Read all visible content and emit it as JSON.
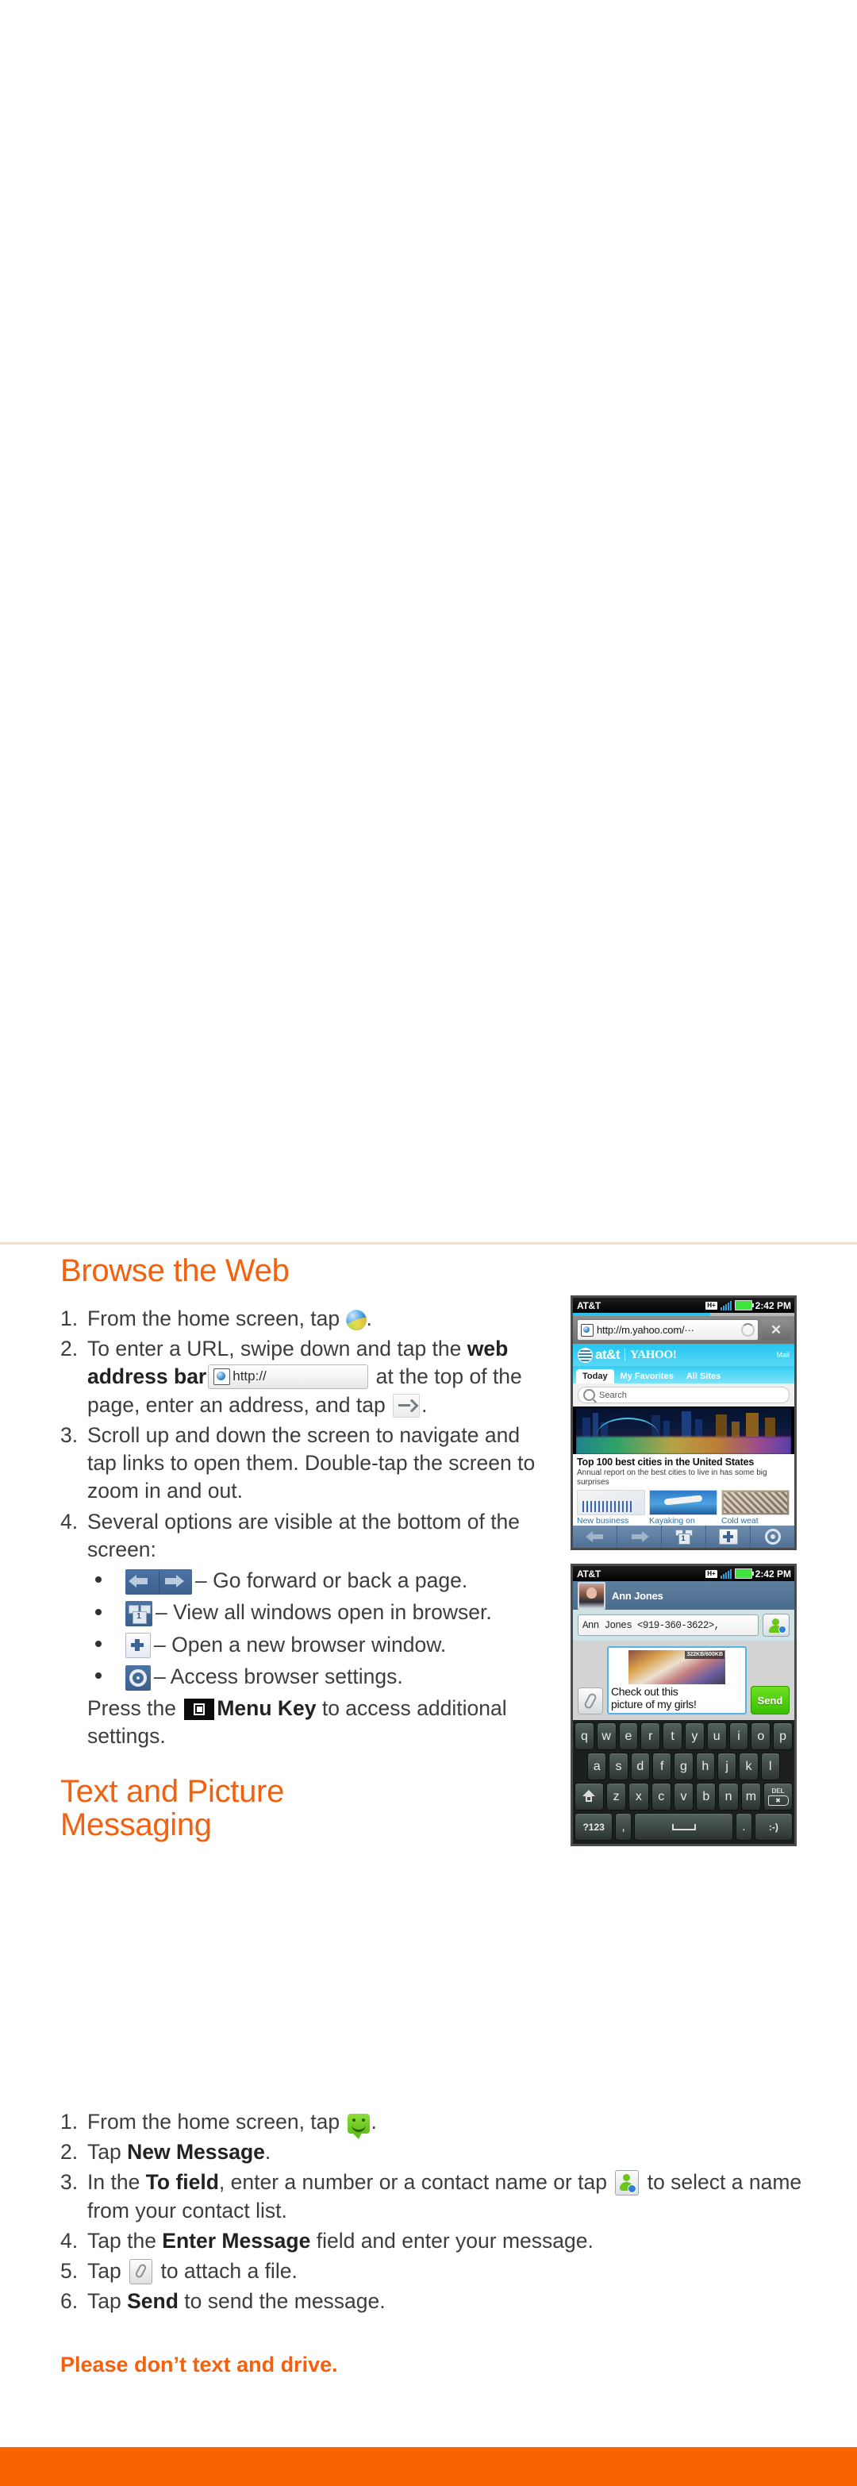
{
  "sections": {
    "browse": {
      "title": "Browse the Web",
      "steps": [
        {
          "num": "1.",
          "pre": "From the home screen, tap ",
          "icon": "browser-globe-icon",
          "post": "."
        },
        {
          "num": "2.",
          "pre": "To enter a URL, swipe down and tap the ",
          "bold": "web address bar",
          "icon": "web-address-bar-icon",
          "mid": " at the top of the page, enter an address, and tap ",
          "icon2": "go-arrow-icon",
          "post": "."
        },
        {
          "num": "3.",
          "pre": "Scroll up and down the screen to navigate and tap links to open them. Double-tap the screen to zoom in and out."
        },
        {
          "num": "4.",
          "pre": "Several options are visible at the bottom of the screen:"
        }
      ],
      "bullets": [
        {
          "icon": "back-forward-arrows-icon",
          "text": "– Go forward or back a page."
        },
        {
          "icon": "view-windows-icon",
          "text": "– View all windows open in browser."
        },
        {
          "icon": "new-window-plus-icon",
          "text": "– Open a new browser window."
        },
        {
          "icon": "browser-settings-gear-icon",
          "text": "– Access browser settings."
        }
      ],
      "note_pre": "Press the ",
      "note_icon": "menu-key-icon",
      "note_bold": "Menu Key",
      "note_post": " to access additional settings."
    },
    "messaging": {
      "title_line1": "Text and Picture",
      "title_line2": "Messaging",
      "steps": [
        {
          "num": "1.",
          "pre": "From the home screen, tap ",
          "icon": "messaging-icon",
          "post": "."
        },
        {
          "num": "2.",
          "pre": "Tap ",
          "bold": "New Message",
          "post": "."
        },
        {
          "num": "3.",
          "pre": "In the ",
          "bold": "To field",
          "mid": ", enter a number or a contact name or tap ",
          "icon": "contact-picker-icon",
          "post": " to select a name from your contact list."
        },
        {
          "num": "4.",
          "pre": "Tap the ",
          "bold": "Enter Message",
          "post": " field and enter your message."
        },
        {
          "num": "5.",
          "pre": "Tap ",
          "icon": "paperclip-icon",
          "post": " to attach a file."
        },
        {
          "num": "6.",
          "pre": "Tap ",
          "bold": "Send",
          "post": " to send the message."
        }
      ],
      "tagline": "Please don’t text and drive."
    }
  },
  "phone_browser": {
    "statusbar": {
      "carrier": "AT&T",
      "network": "H+",
      "time": "2:42 PM"
    },
    "url": "http://m.yahoo.com/···",
    "close_label": "✕",
    "brand_att": "at&t",
    "brand_yahoo": "YAHOO!",
    "mail_link": "Mail",
    "tabs": [
      "Today",
      "My Favorites",
      "All Sites"
    ],
    "active_tab": "Today",
    "search_placeholder": "Search",
    "article_title": "Top 100 best cities in the United States",
    "article_sub": "Annual report on the best cities to live in has some big surprises",
    "thumbs": [
      "New business",
      "Kayaking on",
      "Cold weat"
    ],
    "toolbar": [
      "back",
      "forward",
      "windows",
      "new",
      "settings"
    ],
    "window_count": "1"
  },
  "phone_messaging": {
    "statusbar": {
      "carrier": "AT&T",
      "network": "H+",
      "time": "2:42 PM"
    },
    "contact_name": "Ann Jones",
    "to_field": "Ann Jones <919-360-3622>,",
    "attachment_size": "322KB/600KB",
    "message_line1": "Check out this",
    "message_line2": "picture of my girls!",
    "send_label": "Send",
    "keyboard": {
      "row1": [
        "q",
        "w",
        "e",
        "r",
        "t",
        "y",
        "u",
        "i",
        "o",
        "p"
      ],
      "row2": [
        "a",
        "s",
        "d",
        "f",
        "g",
        "h",
        "j",
        "k",
        "l"
      ],
      "row3_letters": [
        "z",
        "x",
        "c",
        "v",
        "b",
        "n",
        "m"
      ],
      "shift_label": "shift",
      "delete_label": "DEL",
      "row4": [
        "?123",
        ",",
        "space",
        ".",
        ":-)"
      ]
    }
  },
  "colors": {
    "accent_orange": "#f4600c",
    "footer_orange": "#f96400",
    "divider": "#fbdcc6",
    "body_text": "#3d3d3d"
  }
}
